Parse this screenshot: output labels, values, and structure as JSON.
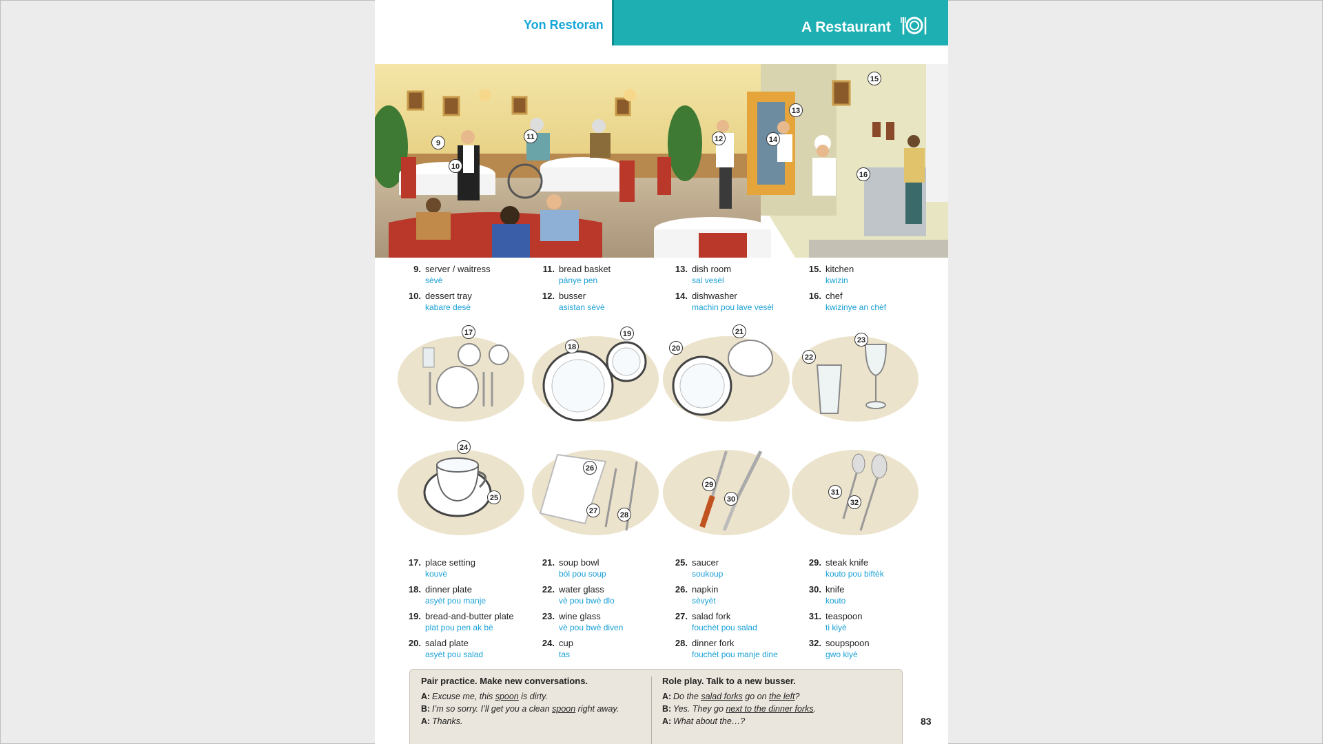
{
  "header": {
    "title_ht": "Yon Restoran",
    "title_en": "A Restaurant"
  },
  "scene_labels": [
    "9",
    "10",
    "11",
    "12",
    "13",
    "14",
    "15",
    "16"
  ],
  "vocab_top": [
    {
      "num": "9.",
      "en": "server / waitress",
      "ht": "sèvè"
    },
    {
      "num": "10.",
      "en": "dessert tray",
      "ht": "kabare desè"
    },
    {
      "num": "11.",
      "en": "bread basket",
      "ht": "pànye pen"
    },
    {
      "num": "12.",
      "en": "busser",
      "ht": "asistan sèvè"
    },
    {
      "num": "13.",
      "en": "dish room",
      "ht": "sal vesèl"
    },
    {
      "num": "14.",
      "en": "dishwasher",
      "ht": "machin pou lave vesèl"
    },
    {
      "num": "15.",
      "en": "kitchen",
      "ht": "kwizin"
    },
    {
      "num": "16.",
      "en": "chef",
      "ht": "kwizinye an chèf"
    }
  ],
  "tile_labels": [
    "17",
    "18",
    "19",
    "20",
    "21",
    "22",
    "23",
    "24",
    "25",
    "26",
    "27",
    "28",
    "29",
    "30",
    "31",
    "32"
  ],
  "vocab_bottom": [
    {
      "num": "17.",
      "en": "place setting",
      "ht": "kouvè"
    },
    {
      "num": "18.",
      "en": "dinner plate",
      "ht": "asyèt pou manje"
    },
    {
      "num": "19.",
      "en": "bread-and-butter plate",
      "ht": "plat pou pen ak bè"
    },
    {
      "num": "20.",
      "en": "salad plate",
      "ht": "asyèt pou salad"
    },
    {
      "num": "21.",
      "en": "soup bowl",
      "ht": "bòl pou soup"
    },
    {
      "num": "22.",
      "en": "water glass",
      "ht": "vè pou bwè dlo"
    },
    {
      "num": "23.",
      "en": "wine glass",
      "ht": "vè pou bwè diven"
    },
    {
      "num": "24.",
      "en": "cup",
      "ht": "tas"
    },
    {
      "num": "25.",
      "en": "saucer",
      "ht": "soukoup"
    },
    {
      "num": "26.",
      "en": "napkin",
      "ht": "sèvyèt"
    },
    {
      "num": "27.",
      "en": "salad fork",
      "ht": "fouchèt pou salad"
    },
    {
      "num": "28.",
      "en": "dinner fork",
      "ht": "fouchèt pou manje dine"
    },
    {
      "num": "29.",
      "en": "steak knife",
      "ht": "kouto pou biftèk"
    },
    {
      "num": "30.",
      "en": "knife",
      "ht": "kouto"
    },
    {
      "num": "31.",
      "en": "teaspoon",
      "ht": "ti kiyè"
    },
    {
      "num": "32.",
      "en": "soupspoon",
      "ht": "gwo kiyè"
    }
  ],
  "practice": {
    "left": {
      "heading": "Pair practice. Make new conversations.",
      "l1_sp": "A:",
      "l1_a": "Excuse me, this ",
      "l1_u": "spoon",
      "l1_b": " is dirty.",
      "l2_sp": "B:",
      "l2_a": "I’m so sorry. I’ll get you a clean ",
      "l2_u": "spoon",
      "l2_b": " right away.",
      "l3_sp": "A:",
      "l3_a": "Thanks."
    },
    "right": {
      "heading": "Role play. Talk to a new busser.",
      "l1_sp": "A:",
      "l1_a": "Do the ",
      "l1_u1": "salad forks",
      "l1_b": " go on ",
      "l1_u2": "the left",
      "l1_c": "?",
      "l2_sp": "B:",
      "l2_a": "Yes. They go ",
      "l2_u": "next to the dinner forks",
      "l2_b": ".",
      "l3_sp": "A:",
      "l3_a": "What about the…?"
    }
  },
  "page_number": "83"
}
